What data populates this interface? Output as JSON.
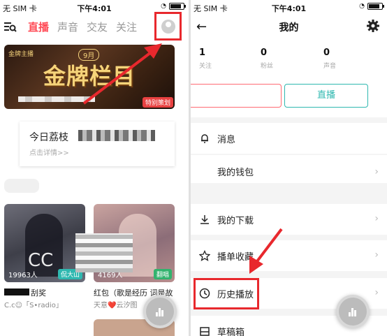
{
  "left_screen": {
    "status": {
      "carrier": "无 SIM 卡",
      "time": "下午4:01"
    },
    "tabs": [
      "直播",
      "声音",
      "交友",
      "关注"
    ],
    "active_tab": "直播",
    "banner": {
      "brand": "金牌主播",
      "month": "9月",
      "title": "金牌栏目",
      "tag": "特别策划"
    },
    "card": {
      "title": "今日荔枝",
      "subtitle": "点击详情>>"
    },
    "tiles": [
      {
        "count": "19963人",
        "badge": "侃大山",
        "title": "刮奖",
        "meta": "C.c☺「S•radio」"
      },
      {
        "count": "4169人",
        "badge": "翻唱",
        "title": "红包（歌是经历 词是故",
        "meta": "天意❤️云汐图"
      }
    ],
    "colors": {
      "accent": "#ff4a55",
      "highlight_red": "#e8282d",
      "teal": "#2fb8b0"
    }
  },
  "right_screen": {
    "status": {
      "carrier": "无 SIM 卡",
      "time": "下午4:01"
    },
    "title": "我的",
    "stats": [
      {
        "num": "1",
        "label": "关注"
      },
      {
        "num": "0",
        "label": "粉丝"
      },
      {
        "num": "0",
        "label": "声音"
      }
    ],
    "live_button": "直播",
    "menu": {
      "messages": "消息",
      "partial": "我的钱包",
      "downloads": "我的下载",
      "favorites": "播单收藏",
      "history": "历史播放",
      "drafts": "草稿箱"
    },
    "chevron": "›"
  }
}
